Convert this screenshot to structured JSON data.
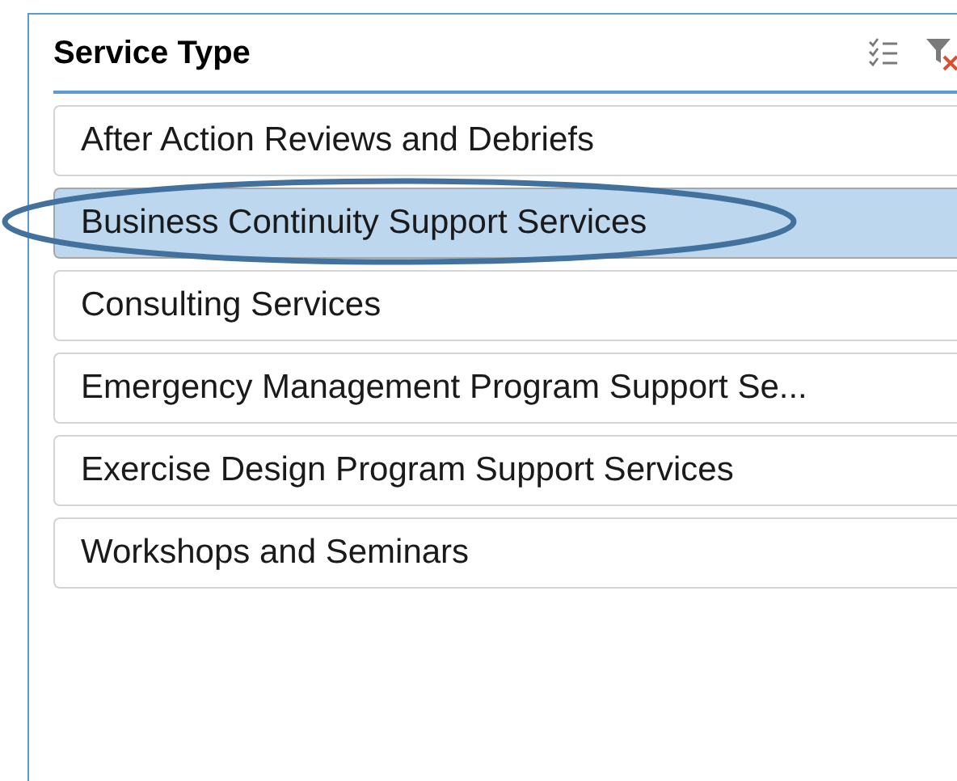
{
  "slicer": {
    "title": "Service Type",
    "multi_select": false,
    "items": [
      {
        "label": "After Action Reviews and Debriefs",
        "selected": false
      },
      {
        "label": "Business Continuity Support Services",
        "selected": true
      },
      {
        "label": "Consulting Services",
        "selected": false
      },
      {
        "label": "Emergency Management Program Support Se...",
        "selected": false
      },
      {
        "label": "Exercise Design Program Support Services",
        "selected": false
      },
      {
        "label": "Workshops and Seminars",
        "selected": false
      }
    ]
  },
  "annotation": {
    "kind": "ellipse"
  }
}
